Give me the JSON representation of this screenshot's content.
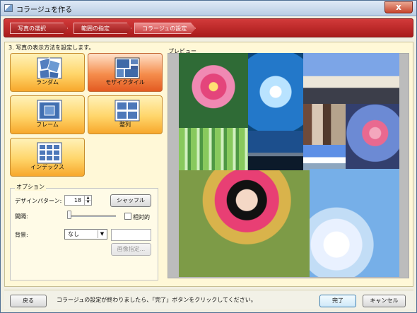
{
  "window": {
    "title": "コラージュを作る",
    "close_label": "x"
  },
  "wizard": {
    "steps": [
      "写真の選択",
      "範囲の指定",
      "コラージュの設定"
    ],
    "active_step": 2
  },
  "layout_section": {
    "heading": "3. 写真の表示方法を設定します。",
    "options": [
      {
        "label": "ランダム",
        "selected": false
      },
      {
        "label": "モザイクタイル",
        "selected": true
      },
      {
        "label": "フレーム",
        "selected": false
      },
      {
        "label": "整列",
        "selected": false
      },
      {
        "label": "インデックス",
        "selected": false
      }
    ]
  },
  "options": {
    "group_title": "オプション",
    "design_pattern_label": "デザインパターン:",
    "design_pattern_value": "18",
    "shuffle_button": "シャッフル",
    "spacing_label": "間隔:",
    "relative_label": "相対的",
    "background_label": "背景:",
    "background_value": "なし",
    "image_select_button": "画像指定..."
  },
  "preview": {
    "label": "プレビュー"
  },
  "footer": {
    "back_button": "戻る",
    "message": "コラージュの設定が終わりましたら、「完了」ボタンをクリックしてください。",
    "finish_button": "完了",
    "cancel_button": "キャンセル"
  },
  "colors": {
    "wizard_red": "#c62f2f",
    "tile_orange": "#f7a72c",
    "selected_orange": "#e35b22",
    "main_bg": "#fff8d7"
  }
}
